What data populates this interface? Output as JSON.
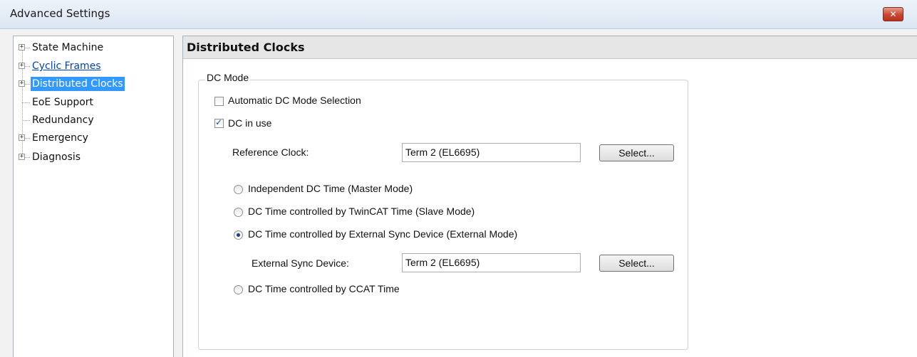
{
  "window": {
    "title": "Advanced Settings",
    "close_icon": "close-icon"
  },
  "tree": {
    "items": [
      {
        "label": "State Machine",
        "expandable": true
      },
      {
        "label": "Cyclic Frames",
        "expandable": true
      },
      {
        "label": "Distributed Clocks",
        "expandable": true,
        "selected": true
      },
      {
        "label": "EoE Support",
        "expandable": false
      },
      {
        "label": "Redundancy",
        "expandable": false
      },
      {
        "label": "Emergency",
        "expandable": true
      },
      {
        "label": "Diagnosis",
        "expandable": true
      }
    ]
  },
  "panel": {
    "title": "Distributed Clocks",
    "group_label": "DC Mode",
    "auto_dc_label": "Automatic DC Mode Selection",
    "auto_dc_checked": false,
    "dc_in_use_label": "DC in use",
    "dc_in_use_checked": true,
    "reference_clock_label": "Reference Clock:",
    "reference_clock_value": "Term 2 (EL6695)",
    "select_label": "Select...",
    "radios": [
      {
        "label": "Independent DC Time (Master Mode)",
        "selected": false
      },
      {
        "label": "DC Time controlled by TwinCAT Time (Slave Mode)",
        "selected": false
      },
      {
        "label": "DC Time controlled by External Sync Device (External Mode)",
        "selected": true
      },
      {
        "label": "DC Time controlled by CCAT Time",
        "selected": false
      }
    ],
    "external_sync_label": "External Sync Device:",
    "external_sync_value": "Term 2 (EL6695)"
  },
  "colors": {
    "selection": "#3399ff",
    "link": "#0645ad",
    "close": "#c9452f"
  }
}
